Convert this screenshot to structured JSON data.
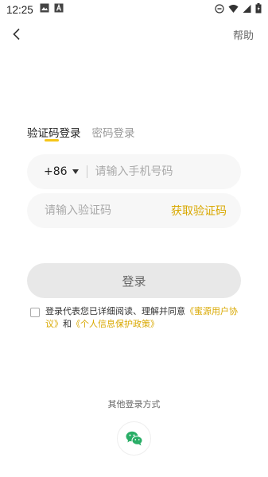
{
  "status_bar": {
    "time": "12:25"
  },
  "nav": {
    "help_label": "帮助"
  },
  "tabs": [
    {
      "label": "验证码登录",
      "active": true
    },
    {
      "label": "密码登录",
      "active": false
    }
  ],
  "phone_field": {
    "country_code": "+86",
    "placeholder": "请输入手机号码",
    "value": ""
  },
  "code_field": {
    "placeholder": "请输入验证码",
    "value": "",
    "get_code_label": "获取验证码"
  },
  "login_button": {
    "label": "登录"
  },
  "agreement": {
    "checked": false,
    "prefix": "登录代表您已详细阅读、理解并同意",
    "link1": "《蜜源用户协议》",
    "middle": "和",
    "link2": "《个人信息保护政策》"
  },
  "other_login": {
    "label": "其他登录方式",
    "methods": [
      "wechat-icon"
    ]
  },
  "colors": {
    "accent": "#d9a800",
    "tab_underline": "#f5c518",
    "wechat_green": "#2aae67"
  }
}
